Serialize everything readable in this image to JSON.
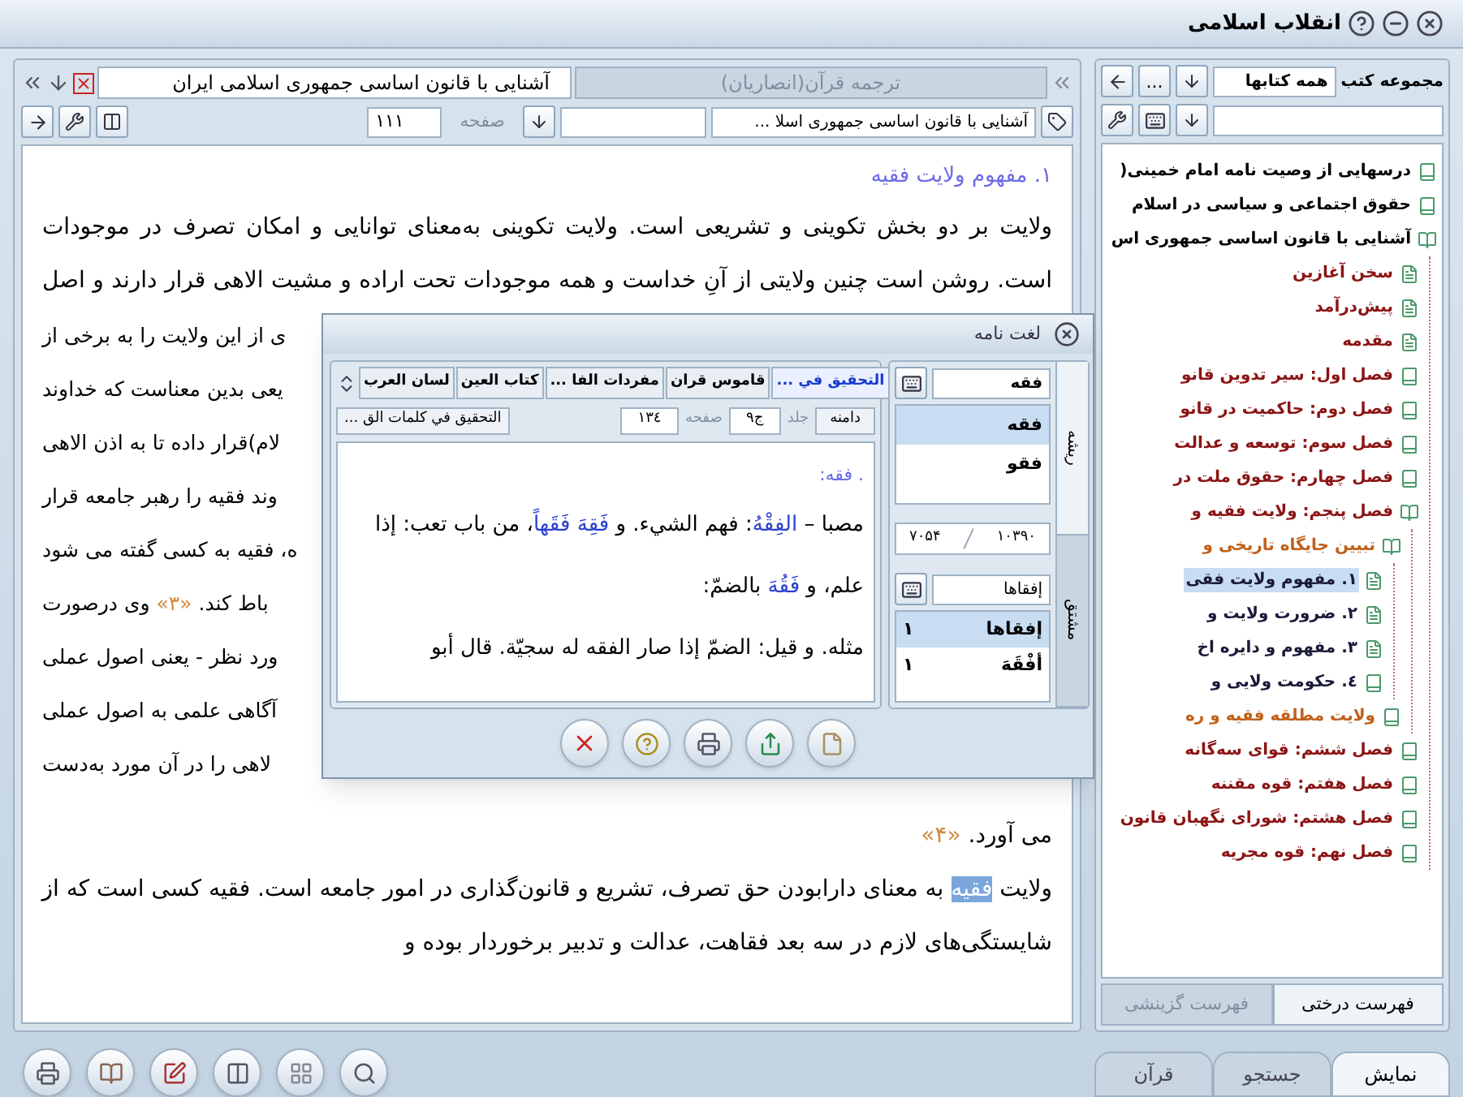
{
  "window": {
    "title": "انقلاب اسلامی"
  },
  "reader": {
    "tabs": [
      {
        "label": "ترجمه قرآن(انصاریان)",
        "selected": false
      },
      {
        "label": "آشنایی با قانون اساسی جمهوری اسلامی ایران",
        "selected": true
      }
    ],
    "book_select": "آشنایی با قانون اساسی جمهوری اسلا ...",
    "page_label": "صفحه",
    "page_value": "۱۱۱",
    "lines": [
      {
        "kind": "heading",
        "segments": [
          {
            "kind": "plain",
            "text": "۱. مفهوم ولایت فقیه"
          }
        ]
      },
      {
        "kind": "full",
        "segments": [
          {
            "kind": "plain",
            "text": "ولایت بر دو بخش تکوینی و تشریعی است. ولایت تکوینی به‌معنای توانایی و امکان تصرف در موجودات"
          }
        ]
      },
      {
        "kind": "full",
        "segments": [
          {
            "kind": "plain",
            "text": "است. روشن است چنین ولایتی از آنِ خداست و همه موجودات تحت اراده و مشیت الاهی قرار دارند و اصل"
          }
        ]
      },
      {
        "kind": "fragment",
        "segments": [
          {
            "kind": "plain",
            "text": "ی از این ولایت را به برخی از"
          }
        ]
      },
      {
        "kind": "fragment",
        "segments": [
          {
            "kind": "plain",
            "text": "یعی بدین معناست که خداوند"
          }
        ]
      },
      {
        "kind": "fragment",
        "segments": [
          {
            "kind": "plain",
            "text": "لام)قرار داده تا به اذن الاهی"
          }
        ]
      },
      {
        "kind": "fragment",
        "segments": [
          {
            "kind": "plain",
            "text": "وند فقیه را رهبر جامعه قرار"
          }
        ]
      },
      {
        "kind": "fragment",
        "segments": [
          {
            "kind": "plain",
            "text": "ه، فقیه به کسی گفته می شود"
          }
        ]
      },
      {
        "kind": "fragment",
        "segments": [
          {
            "kind": "plain",
            "text": "باط کند. "
          },
          {
            "kind": "note",
            "text": "«۳»"
          },
          {
            "kind": "plain",
            "text": " وی درصورت"
          }
        ]
      },
      {
        "kind": "fragment",
        "segments": [
          {
            "kind": "plain",
            "text": "ورد نظر - یعنی اصول عملی"
          }
        ]
      },
      {
        "kind": "fragment",
        "segments": [
          {
            "kind": "plain",
            "text": "آگاهی علمی به اصول عملی"
          }
        ]
      },
      {
        "kind": "fragment",
        "segments": [
          {
            "kind": "plain",
            "text": "لاهی را در آن مورد به‌دست"
          }
        ]
      },
      {
        "kind": "last",
        "segments": [
          {
            "kind": "plain",
            "text": "می آورد. "
          },
          {
            "kind": "note",
            "text": "«۴»"
          }
        ]
      },
      {
        "kind": "full",
        "segments": [
          {
            "kind": "plain",
            "text": "ولایت "
          },
          {
            "kind": "highlight",
            "text": "فقیه"
          },
          {
            "kind": "plain",
            "text": " به معنای دارابودن حق تصرف، تشریع و قانون‌گذاری در امور جامعه است. فقیه کسی است که از"
          }
        ]
      },
      {
        "kind": "last",
        "segments": [
          {
            "kind": "plain",
            "text": "شایستگی‌های لازم در سه بعد فقاهت، عدالت و تدبیر برخوردار بوده و"
          }
        ]
      }
    ]
  },
  "library": {
    "label": "مجموعه کتب",
    "collection": "همه کتابها",
    "more_button": "...",
    "tree": [
      {
        "label": "درسهایی از وصیت نامه امام خمینی(",
        "kind": "book",
        "selected": false
      },
      {
        "label": "حقوق اجتماعی و سیاسی در اسلام",
        "kind": "book",
        "selected": false
      },
      {
        "label": "آشنایی با قانون اساسی جمهوری اس",
        "kind": "open",
        "selected": false,
        "children": [
          {
            "label": "سخن آغازین",
            "kind": "page",
            "selected": false
          },
          {
            "label": "پیش‌درآمد",
            "kind": "page",
            "selected": false
          },
          {
            "label": "مقدمه",
            "kind": "page",
            "selected": false
          },
          {
            "label": "فصل اول: سیر تدوین قانو",
            "kind": "book",
            "selected": false
          },
          {
            "label": "فصل دوم: حاکمیت در قانو",
            "kind": "book",
            "selected": false
          },
          {
            "label": "فصل سوم: توسعه و عدالت",
            "kind": "book",
            "selected": false
          },
          {
            "label": "فصل چهارم: حقوق ملت در",
            "kind": "book",
            "selected": false
          },
          {
            "label": "فصل پنجم: ولایت فقیه و",
            "kind": "open",
            "selected": false,
            "children": [
              {
                "label": "تبیین جایگاه تاریخی و",
                "kind": "open",
                "selected": false,
                "children": [
                  {
                    "label": "۱. مفهوم ولایت فقی",
                    "kind": "page",
                    "selected": true
                  },
                  {
                    "label": "۲. ضرورت ولایت و",
                    "kind": "page",
                    "selected": false
                  },
                  {
                    "label": "۳. مفهوم و دایره اخ",
                    "kind": "page",
                    "selected": false
                  },
                  {
                    "label": "٤. حکومت ولایی و",
                    "kind": "book",
                    "selected": false
                  }
                ]
              },
              {
                "label": "ولایت مطلقه فقیه و ره",
                "kind": "book",
                "selected": false
              }
            ]
          },
          {
            "label": "فصل ششم: قوای سه‌گانه",
            "kind": "book",
            "selected": false
          },
          {
            "label": "فصل هفتم: قوه مقننه",
            "kind": "book",
            "selected": false
          },
          {
            "label": "فصل هشتم: شورای نگهبان قانون",
            "kind": "book",
            "selected": false
          },
          {
            "label": "فصل نهم: قوه مجریه",
            "kind": "book",
            "selected": false
          }
        ]
      }
    ],
    "list_tabs": [
      {
        "label": "فهرست درختی",
        "selected": true
      },
      {
        "label": "فهرست گزینشی",
        "selected": false
      }
    ]
  },
  "nav_tabs": [
    {
      "label": "نمایش",
      "selected": true
    },
    {
      "label": "جستجو",
      "selected": false
    },
    {
      "label": "قرآن",
      "selected": false
    }
  ],
  "dictionary": {
    "title": "لغت نامه",
    "books": [
      {
        "label": "التحقیق في ...",
        "selected": true
      },
      {
        "label": "قاموس قران",
        "selected": false
      },
      {
        "label": "مفردات الفا ...",
        "selected": false
      },
      {
        "label": "كتاب العين",
        "selected": false
      },
      {
        "label": "لسان العرب",
        "selected": false
      }
    ],
    "scope_button": "دامنه",
    "volume_label": "جلد",
    "volume": "ج۹",
    "page_label": "صفحه",
    "page": "۱۳٤",
    "source": "التحقيق في كلمات الق ...",
    "entry_heading": ". فقه:",
    "entry_lines": [
      [
        {
          "kind": "plain",
          "text": "مصبا – "
        },
        {
          "kind": "term",
          "text": "الفِقْهُ"
        },
        {
          "kind": "plain",
          "text": ": فهم الشيء. و "
        },
        {
          "kind": "term",
          "text": "فَقِهَ فَقَهاً"
        },
        {
          "kind": "plain",
          "text": "، من باب تعب: إذا"
        }
      ],
      [
        {
          "kind": "plain",
          "text": "علم، و "
        },
        {
          "kind": "term",
          "text": "فَقُهَ"
        },
        {
          "kind": "plain",
          "text": " بالضمّ:"
        }
      ],
      [
        {
          "kind": "plain",
          "text": "مثله. و قيل: الضمّ إذا صار الفقه له سجيّة. قال أبو"
        }
      ]
    ],
    "side_tabs": [
      {
        "label": "ریشه",
        "selected": true
      },
      {
        "label": "مشتق",
        "selected": false
      }
    ],
    "root_search": "فقه",
    "roots": [
      {
        "text": "فقه",
        "selected": true
      },
      {
        "text": "فقو",
        "selected": false
      }
    ],
    "counter": {
      "current": "۷۰۵۴",
      "total": "۱۰۳۹۰"
    },
    "derived_search": "إفقاها",
    "derived": [
      {
        "word": "إفقاها",
        "count": "۱",
        "selected": true
      },
      {
        "word": "أفْقَهَ",
        "count": "۱",
        "selected": false
      }
    ]
  }
}
